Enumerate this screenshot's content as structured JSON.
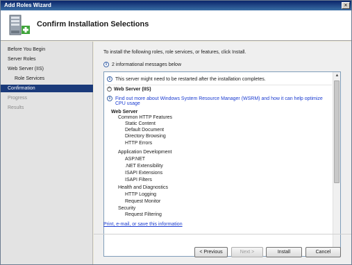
{
  "window": {
    "title": "Add Roles Wizard",
    "close_glyph": "×"
  },
  "header": {
    "title": "Confirm Installation Selections",
    "icon": "server-install-icon"
  },
  "nav": {
    "items": [
      {
        "label": "Before You Begin",
        "state": "normal"
      },
      {
        "label": "Server Roles",
        "state": "normal"
      },
      {
        "label": "Web Server (IIS)",
        "state": "normal"
      },
      {
        "label": "Role Services",
        "state": "normal"
      },
      {
        "label": "Confirmation",
        "state": "active"
      },
      {
        "label": "Progress",
        "state": "disabled"
      },
      {
        "label": "Results",
        "state": "disabled"
      }
    ]
  },
  "main": {
    "intro": "To install the following roles, role services, or features, click Install.",
    "messages_count": "2 informational messages below",
    "info_glyph": "i",
    "restart_note": "This server might need to be restarted after the installation completes.",
    "section_title": "Web Server (IIS)",
    "section_glyph": "^",
    "wsrm_link_line1": "Find out more about Windows System Resource Manager (WSRM) and how it can help optimize",
    "wsrm_link_line2": "CPU usage",
    "tree": {
      "root": "Web Server",
      "groups": [
        {
          "label": "Common HTTP Features",
          "items": [
            "Static Content",
            "Default Document",
            "Directory Browsing",
            "HTTP Errors"
          ]
        },
        {
          "label": "Application Development",
          "items": [
            "ASP.NET",
            ".NET Extensibility",
            "ISAPI Extensions",
            "ISAPI Filters"
          ]
        },
        {
          "label": "Health and Diagnostics",
          "items": [
            "HTTP Logging",
            "Request Monitor"
          ]
        },
        {
          "label": "Security",
          "items": [
            "Request Filtering"
          ]
        }
      ]
    },
    "print_link": "Print, e-mail, or save this information",
    "scroll_up_glyph": "▲",
    "scroll_down_glyph": "▼"
  },
  "buttons": {
    "previous": "< Previous",
    "next": "Next >",
    "install": "Install",
    "cancel": "Cancel"
  }
}
